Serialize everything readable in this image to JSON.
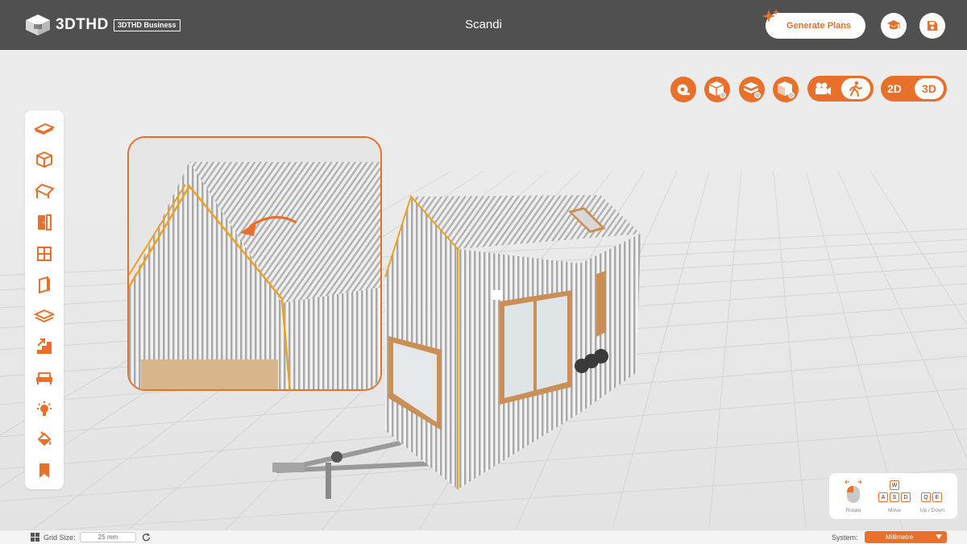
{
  "app": {
    "logo_text": "3DTHD",
    "business_badge": "3DTHD Business",
    "project_title": "Scandi"
  },
  "header": {
    "generate_plans_label": "Generate Plans",
    "learn_icon": "graduation-cap-icon",
    "save_icon": "save-disk-icon"
  },
  "left_toolbar": {
    "tools": [
      "floor-platform-icon",
      "cube-walls-icon",
      "roof-icon",
      "door-icon",
      "window-icon",
      "wall-panel-icon",
      "layer-floor-icon",
      "stairs-icon",
      "sofa-icon",
      "light-bulb-icon",
      "paint-bucket-icon",
      "bookmark-icon"
    ]
  },
  "view_controls": {
    "buttons": [
      "measure-tape-icon",
      "view-cube-icon",
      "layers-view-icon",
      "corner-view-icon"
    ],
    "camera_mode": "walk",
    "dimension_2d_label": "2D",
    "dimension_3d_label": "3D",
    "dimension_selected": "3D"
  },
  "controls_help": {
    "rotate_label": "Rotate",
    "move_label": "Move",
    "updown_label": "Up / Down",
    "keys_move": [
      "W",
      "A",
      "S",
      "D"
    ],
    "keys_updown": [
      "Q",
      "E"
    ]
  },
  "bottom_bar": {
    "grid_size_label": "Grid Size:",
    "grid_size_value": "25 mm",
    "system_label": "System:",
    "system_value": "Millimetre"
  },
  "colors": {
    "accent": "#e8702a",
    "topbar": "#505050",
    "floor": "#ebebeb"
  }
}
